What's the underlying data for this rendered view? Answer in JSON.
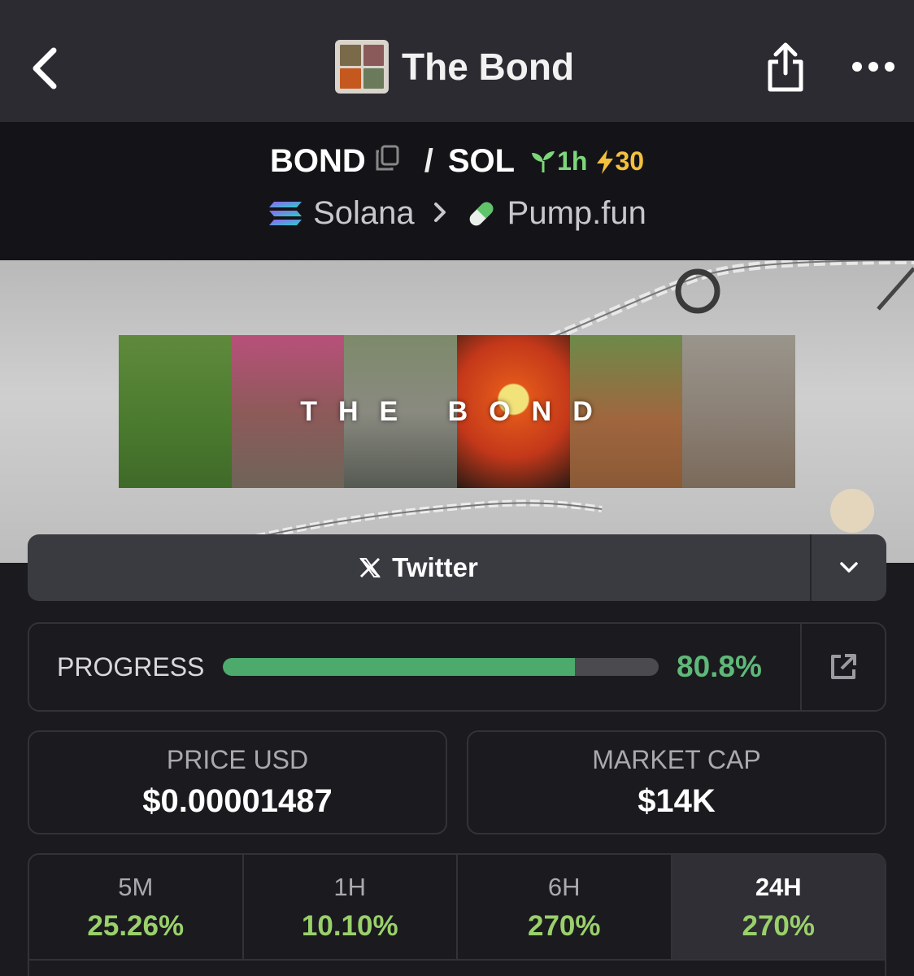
{
  "header": {
    "title": "The Bond"
  },
  "pair": {
    "base": "BOND",
    "quote": "SOL",
    "separator": "/",
    "age": "1h",
    "boosts": "30",
    "chain": "Solana",
    "dex": "Pump.fun"
  },
  "banner": {
    "title": "THE BOND"
  },
  "links": {
    "twitter_label": "Twitter"
  },
  "progress": {
    "label": "PROGRESS",
    "value_text": "80.8%",
    "fraction": 0.808
  },
  "stats": {
    "price_label": "PRICE USD",
    "price_value": "$0.00001487",
    "mcap_label": "MARKET CAP",
    "mcap_value": "$14K"
  },
  "changes": [
    {
      "label": "5M",
      "value": "25.26%"
    },
    {
      "label": "1H",
      "value": "10.10%"
    },
    {
      "label": "6H",
      "value": "270%"
    },
    {
      "label": "24H",
      "value": "270%"
    }
  ],
  "colors": {
    "positive": "#9ad06b",
    "progress": "#4caa6c",
    "boost": "#f4c13c"
  },
  "icons": [
    "back-chevron-icon",
    "share-icon",
    "more-icon",
    "copy-icon",
    "seedling-icon",
    "lightning-icon",
    "solana-icon",
    "pill-icon",
    "x-logo-icon",
    "chevron-down-icon",
    "external-link-icon"
  ]
}
